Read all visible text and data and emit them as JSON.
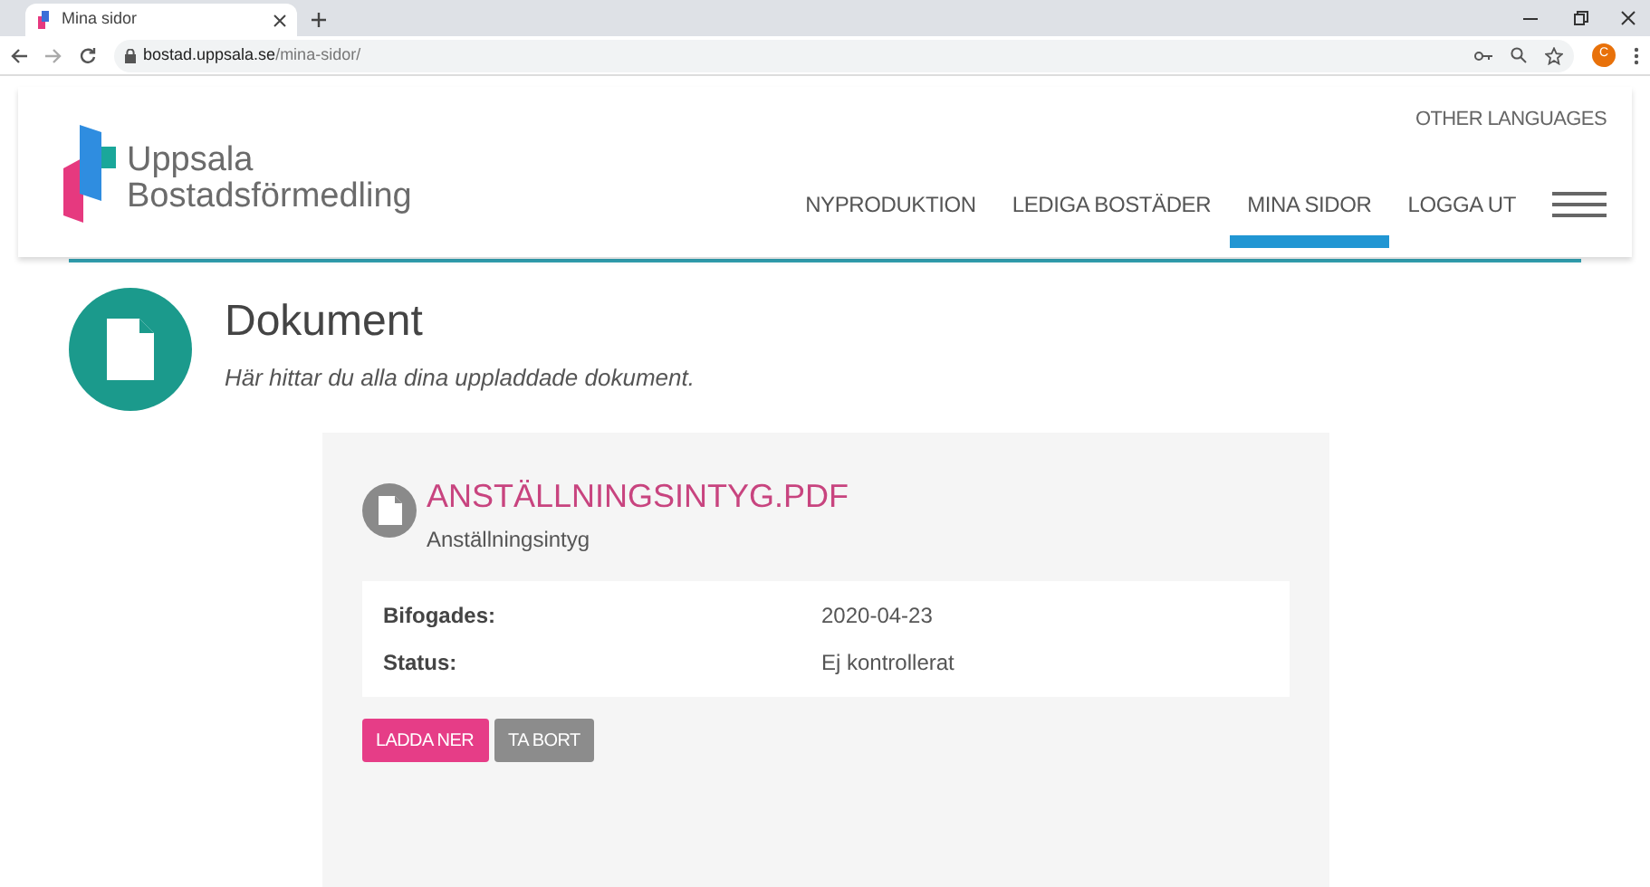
{
  "browser": {
    "tab_title": "Mina sidor",
    "url_host": "bostad.uppsala.se",
    "url_path": "/mina-sidor/",
    "profile_initial": "C"
  },
  "logo": {
    "line1": "Uppsala",
    "line2": "Bostadsförmedling"
  },
  "other_languages": "OTHER LANGUAGES",
  "nav": [
    {
      "label": "NYPRODUKTION",
      "selected": false
    },
    {
      "label": "LEDIGA BOSTÄDER",
      "selected": false
    },
    {
      "label": "MINA SIDOR",
      "selected": true
    },
    {
      "label": "LOGGA UT",
      "selected": false
    }
  ],
  "page": {
    "title": "Dokument",
    "subtitle": "Här hittar du alla dina uppladdade dokument."
  },
  "documents": [
    {
      "filename": "ANSTÄLLNINGSINTYG.PDF",
      "type": "Anställningsintyg",
      "details": [
        {
          "label": "Bifogades:",
          "value": "2020-04-23"
        },
        {
          "label": "Status:",
          "value": "Ej kontrollerat"
        }
      ],
      "buttons": [
        {
          "label": "LADDA NER",
          "kind": "primary"
        },
        {
          "label": "TA BORT",
          "kind": "secondary"
        }
      ]
    }
  ]
}
